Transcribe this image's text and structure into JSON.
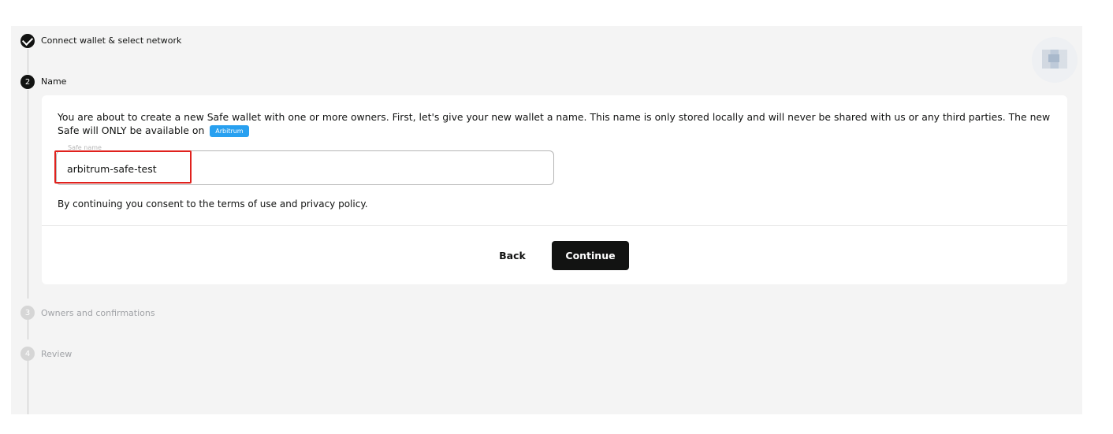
{
  "stepper": {
    "steps": [
      {
        "number": "",
        "label": "Connect wallet & select network",
        "status": "completed"
      },
      {
        "number": "2",
        "label": "Name",
        "status": "active"
      },
      {
        "number": "3",
        "label": "Owners and confirmations",
        "status": "pending"
      },
      {
        "number": "4",
        "label": "Review",
        "status": "pending"
      }
    ]
  },
  "name_step": {
    "description": "You are about to create a new Safe wallet with one or more owners. First, let's give your new wallet a name. This name is only stored locally and will never be shared with us or any third parties. The new Safe will ONLY be available on",
    "network_chip": "Arbitrum",
    "field_label": "Safe name",
    "field_value": "arbitrum-safe-test",
    "consent": "By continuing you consent to the terms of use and privacy policy.",
    "back_label": "Back",
    "continue_label": "Continue"
  },
  "colors": {
    "primary": "#121312",
    "network_chip": "#28a0f0",
    "highlight": "#e0211d",
    "panel_bg": "#f4f4f4"
  }
}
